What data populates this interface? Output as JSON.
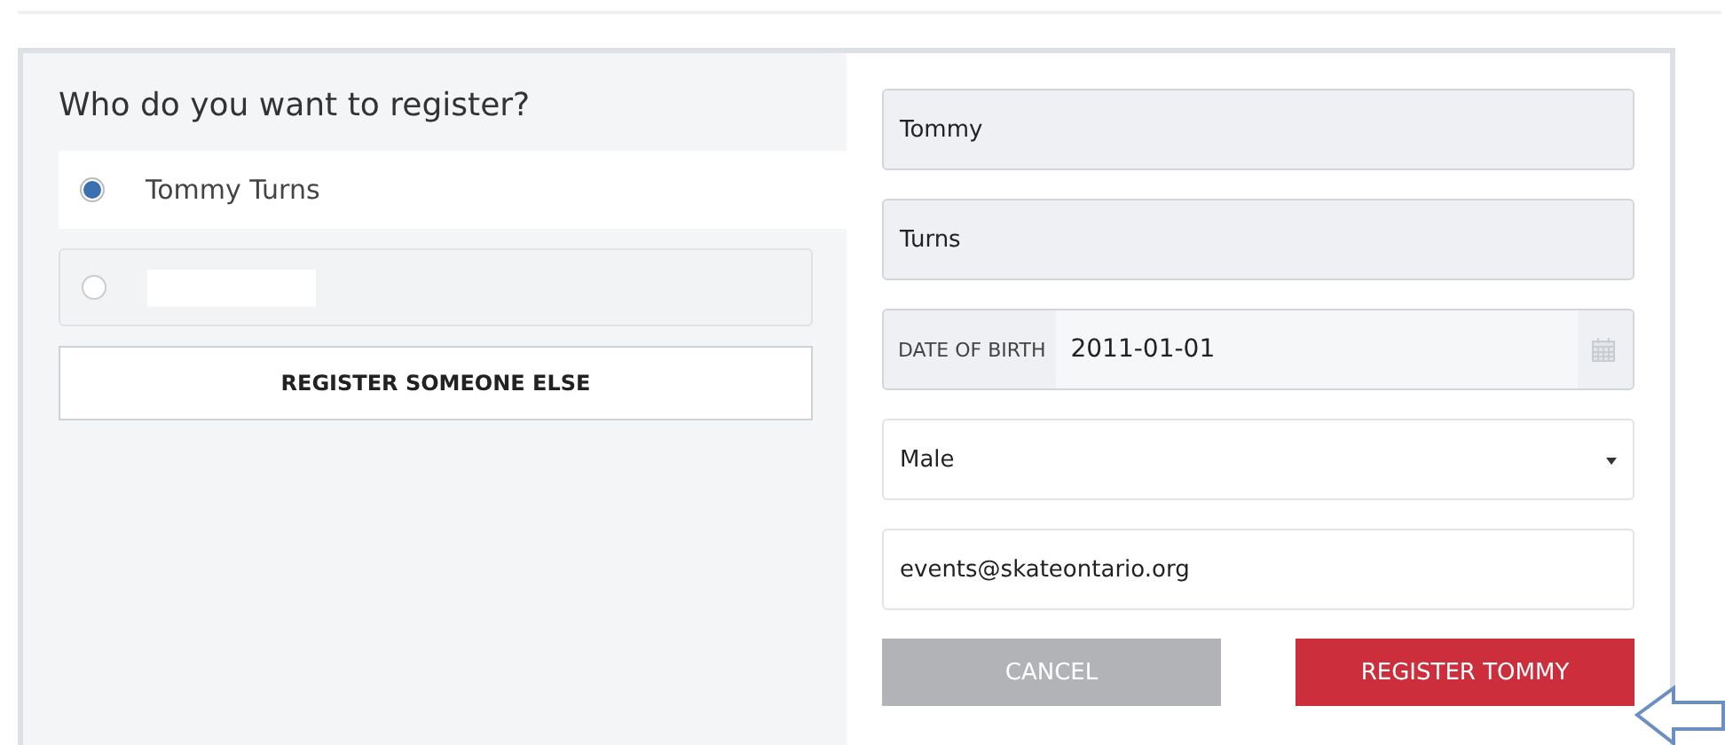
{
  "question": "Who do you want to register?",
  "options": [
    {
      "label": "Tommy Turns",
      "selected": true
    },
    {
      "selected": false
    }
  ],
  "register_other_button": "REGISTER SOMEONE ELSE",
  "fields": [
    {
      "kind": "text",
      "value": "Tommy",
      "disabled": true
    },
    {
      "kind": "text",
      "value": "Turns",
      "disabled": true
    },
    {
      "kind": "date",
      "label": "DATE OF BIRTH",
      "value": "2011-01-01",
      "disabled": true
    },
    {
      "kind": "select",
      "value": "Male",
      "disabled": false
    },
    {
      "kind": "text",
      "value": "events@skateontario.org",
      "disabled": false
    }
  ],
  "cancel_button": "CANCEL",
  "submit_button": "REGISTER TOMMY"
}
